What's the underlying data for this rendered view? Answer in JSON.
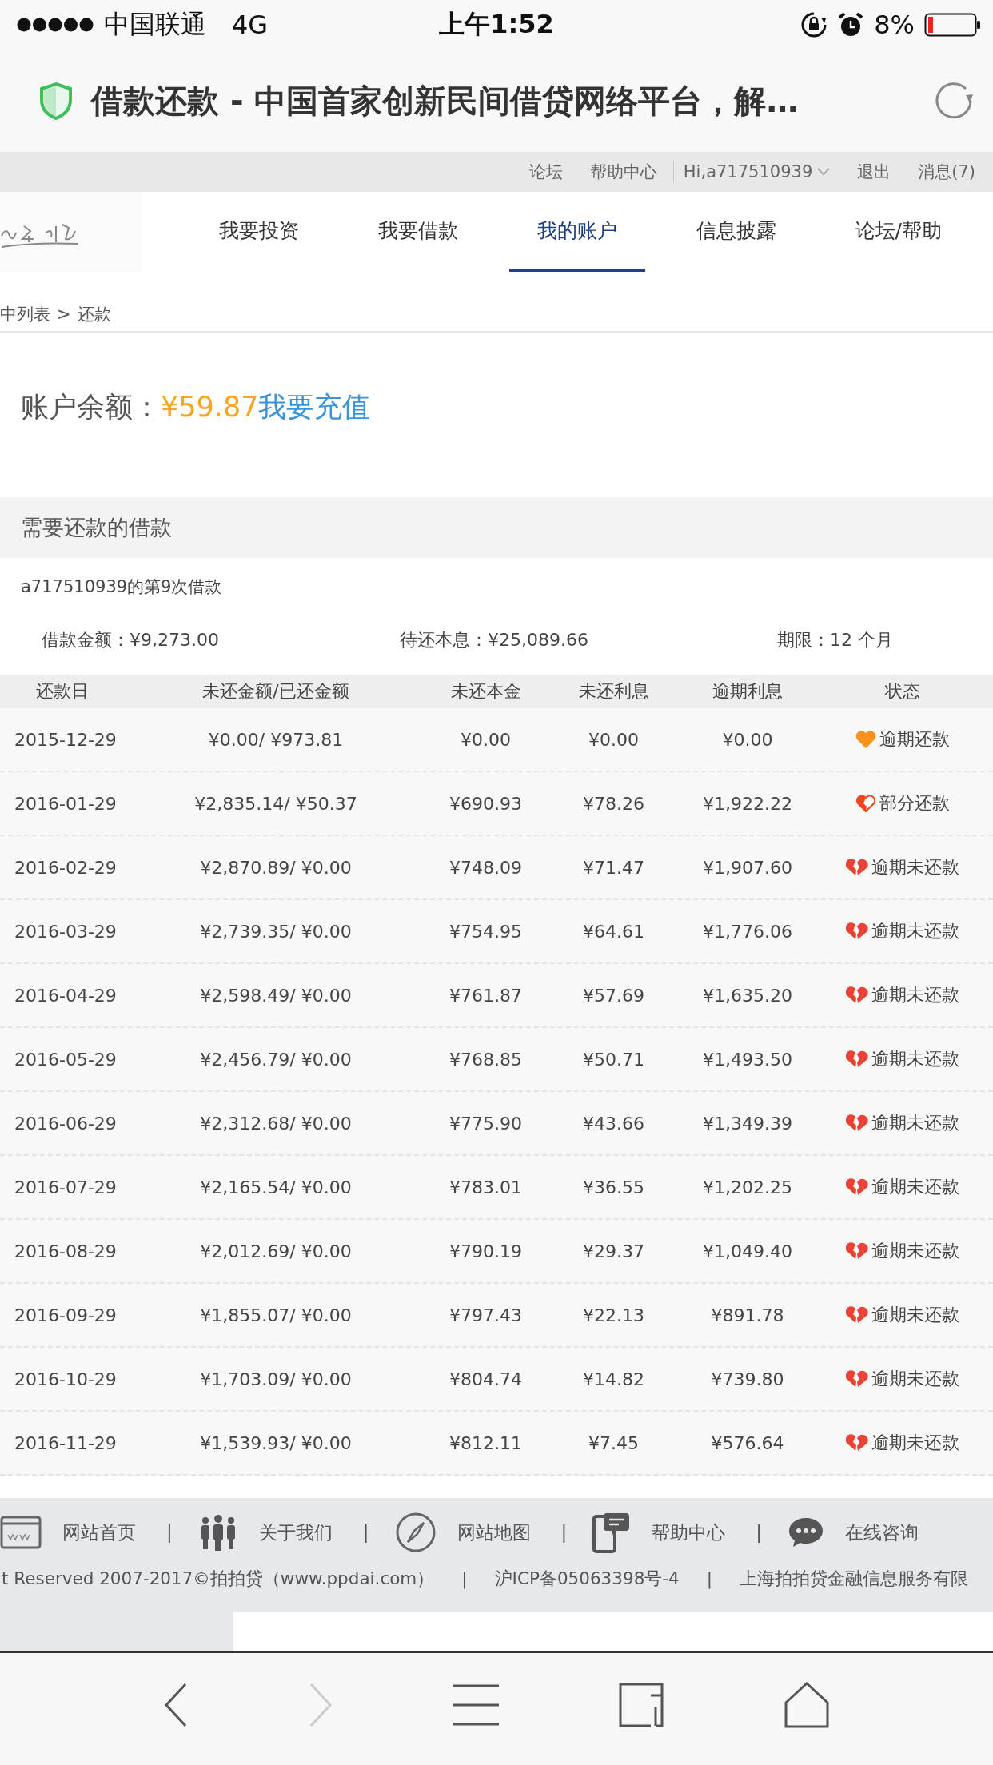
{
  "status_bar": {
    "carrier": "中国联通",
    "network": "4G",
    "time": "上午1:52",
    "battery": "8%"
  },
  "browser": {
    "page_title": "借款还款 - 中国首家创新民间借贷网络平台，解…"
  },
  "top_bar": {
    "links": [
      "论坛",
      "帮助中心"
    ],
    "user": "Hi,a717510939",
    "actions": [
      "退出",
      "消息(7)"
    ]
  },
  "nav": [
    {
      "label": "我要投资",
      "selected": false
    },
    {
      "label": "我要借款",
      "selected": false
    },
    {
      "label": "我的账户",
      "selected": true
    },
    {
      "label": "信息披露",
      "selected": false
    },
    {
      "label": "论坛/帮助",
      "selected": false
    }
  ],
  "breadcrumb": {
    "parent": "中列表",
    "separator": ">",
    "current": "还款"
  },
  "balance": {
    "label": "账户余额：",
    "amount": "¥59.87",
    "action": "我要充值"
  },
  "section_title": "需要还款的借款",
  "loan": {
    "title": "a717510939的第9次借款",
    "amount": "借款金额：¥9,273.00",
    "outstanding": "待还本息：¥25,089.66",
    "term": "期限：12 个月"
  },
  "table": {
    "columns": [
      "还款日",
      "未还金额/已还金额",
      "未还本金",
      "未还利息",
      "逾期利息",
      "状态"
    ],
    "rows": [
      {
        "date": "2015-12-29",
        "unpaid_paid": "¥0.00/ ¥973.81",
        "principal": "¥0.00",
        "interest": "¥0.00",
        "overdue_interest": "¥0.00",
        "status": "逾期还款",
        "kind": "repaid"
      },
      {
        "date": "2016-01-29",
        "unpaid_paid": "¥2,835.14/ ¥50.37",
        "principal": "¥690.93",
        "interest": "¥78.26",
        "overdue_interest": "¥1,922.22",
        "status": "部分还款",
        "kind": "partial"
      },
      {
        "date": "2016-02-29",
        "unpaid_paid": "¥2,870.89/ ¥0.00",
        "principal": "¥748.09",
        "interest": "¥71.47",
        "overdue_interest": "¥1,907.60",
        "status": "逾期未还款",
        "kind": "overdue"
      },
      {
        "date": "2016-03-29",
        "unpaid_paid": "¥2,739.35/ ¥0.00",
        "principal": "¥754.95",
        "interest": "¥64.61",
        "overdue_interest": "¥1,776.06",
        "status": "逾期未还款",
        "kind": "overdue"
      },
      {
        "date": "2016-04-29",
        "unpaid_paid": "¥2,598.49/ ¥0.00",
        "principal": "¥761.87",
        "interest": "¥57.69",
        "overdue_interest": "¥1,635.20",
        "status": "逾期未还款",
        "kind": "overdue"
      },
      {
        "date": "2016-05-29",
        "unpaid_paid": "¥2,456.79/ ¥0.00",
        "principal": "¥768.85",
        "interest": "¥50.71",
        "overdue_interest": "¥1,493.50",
        "status": "逾期未还款",
        "kind": "overdue"
      },
      {
        "date": "2016-06-29",
        "unpaid_paid": "¥2,312.68/ ¥0.00",
        "principal": "¥775.90",
        "interest": "¥43.66",
        "overdue_interest": "¥1,349.39",
        "status": "逾期未还款",
        "kind": "overdue"
      },
      {
        "date": "2016-07-29",
        "unpaid_paid": "¥2,165.54/ ¥0.00",
        "principal": "¥783.01",
        "interest": "¥36.55",
        "overdue_interest": "¥1,202.25",
        "status": "逾期未还款",
        "kind": "overdue"
      },
      {
        "date": "2016-08-29",
        "unpaid_paid": "¥2,012.69/ ¥0.00",
        "principal": "¥790.19",
        "interest": "¥29.37",
        "overdue_interest": "¥1,049.40",
        "status": "逾期未还款",
        "kind": "overdue"
      },
      {
        "date": "2016-09-29",
        "unpaid_paid": "¥1,855.07/ ¥0.00",
        "principal": "¥797.43",
        "interest": "¥22.13",
        "overdue_interest": "¥891.78",
        "status": "逾期未还款",
        "kind": "overdue"
      },
      {
        "date": "2016-10-29",
        "unpaid_paid": "¥1,703.09/ ¥0.00",
        "principal": "¥804.74",
        "interest": "¥14.82",
        "overdue_interest": "¥739.80",
        "status": "逾期未还款",
        "kind": "overdue"
      },
      {
        "date": "2016-11-29",
        "unpaid_paid": "¥1,539.93/ ¥0.00",
        "principal": "¥812.11",
        "interest": "¥7.45",
        "overdue_interest": "¥576.64",
        "status": "逾期未还款",
        "kind": "overdue"
      }
    ]
  },
  "footer": {
    "links": [
      {
        "label": "网站首页",
        "kind": "home",
        "separator": "|"
      },
      {
        "label": "关于我们",
        "kind": "about",
        "separator": "|"
      },
      {
        "label": "网站地图",
        "kind": "map",
        "separator": "|"
      },
      {
        "label": "帮助中心",
        "kind": "help",
        "separator": "|"
      },
      {
        "label": "在线咨询",
        "kind": "chat"
      }
    ],
    "copyright": [
      {
        "text": "t Reserved 2007-2017©拍拍贷（www.ppdai.com）",
        "separator": "|"
      },
      {
        "text": "沪ICP备05063398号-4",
        "separator": "|"
      },
      {
        "text": "上海拍拍贷金融信息服务有限"
      }
    ]
  },
  "toolbar": [
    {
      "kind": "back",
      "disabled": false
    },
    {
      "kind": "forward",
      "disabled": true
    },
    {
      "kind": "menu",
      "disabled": false
    },
    {
      "kind": "tabs",
      "disabled": false
    },
    {
      "kind": "home",
      "disabled": false
    }
  ]
}
